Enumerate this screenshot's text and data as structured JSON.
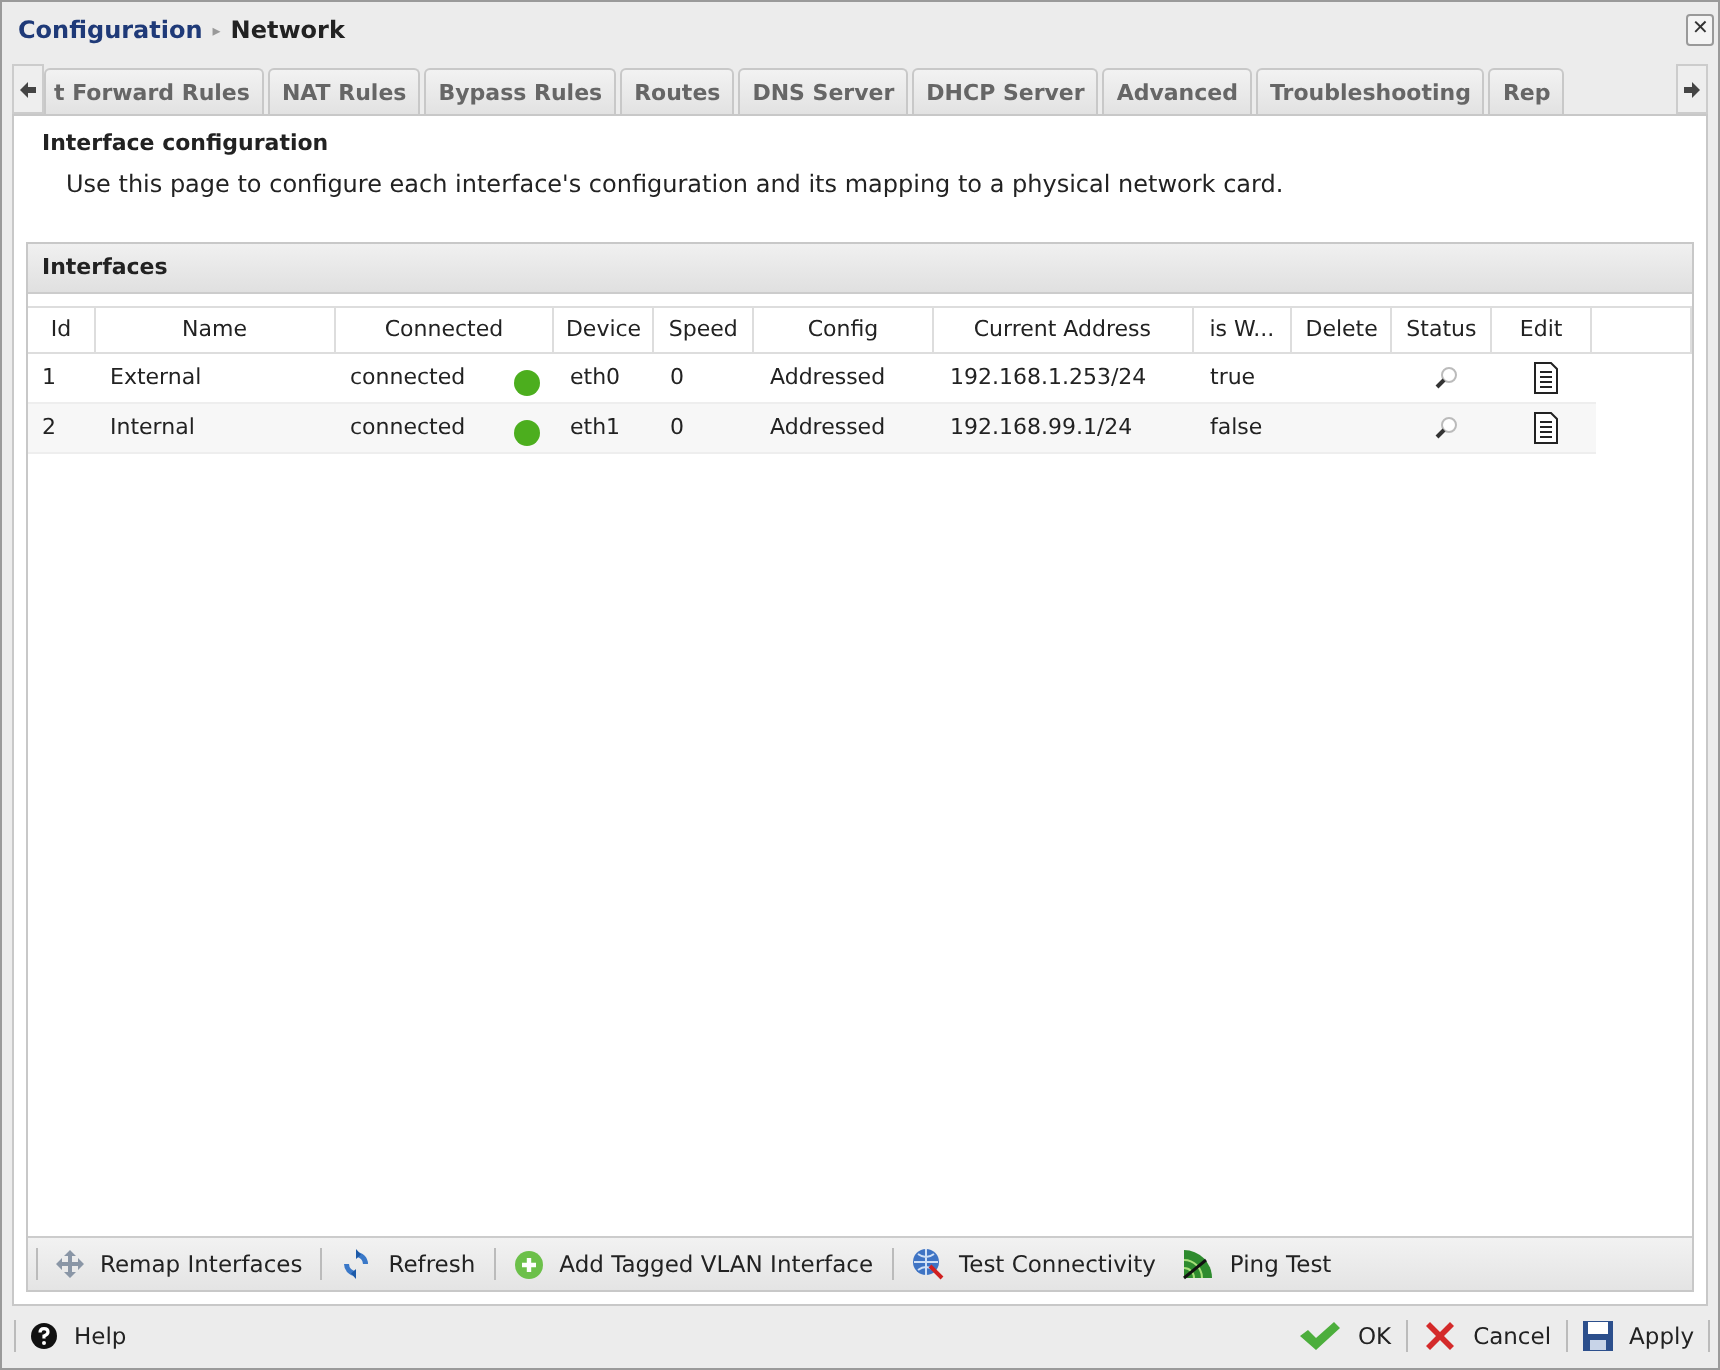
{
  "breadcrumb": {
    "parent": "Configuration",
    "separator": "▸",
    "current": "Network"
  },
  "close": "✕",
  "tabs": [
    {
      "label": "t Forward Rules",
      "selected": false
    },
    {
      "label": "NAT Rules",
      "selected": false
    },
    {
      "label": "Bypass Rules",
      "selected": false
    },
    {
      "label": "Routes",
      "selected": false
    },
    {
      "label": "DNS Server",
      "selected": false
    },
    {
      "label": "DHCP Server",
      "selected": false
    },
    {
      "label": "Advanced",
      "selected": false
    },
    {
      "label": "Troubleshooting",
      "selected": false
    },
    {
      "label": "Rep",
      "selected": false
    }
  ],
  "heading": "Interface configuration",
  "description": "Use this page to configure each interface's configuration and its mapping to a physical network card.",
  "panel": {
    "title": "Interfaces",
    "columns": [
      "Id",
      "Name",
      "Connected",
      "Device",
      "Speed",
      "Config",
      "Current Address",
      "is W...",
      "Delete",
      "Status",
      "Edit"
    ],
    "rows": [
      {
        "id": "1",
        "name": "External",
        "connected": "connected",
        "connected_ok": true,
        "device": "eth0",
        "speed": "0",
        "config": "Addressed",
        "address": "192.168.1.253/24",
        "is_wan": "true"
      },
      {
        "id": "2",
        "name": "Internal",
        "connected": "connected",
        "connected_ok": true,
        "device": "eth1",
        "speed": "0",
        "config": "Addressed",
        "address": "192.168.99.1/24",
        "is_wan": "false"
      }
    ],
    "toolbar": [
      {
        "kind": "move",
        "label": "Remap Interfaces"
      },
      {
        "kind": "refresh",
        "label": "Refresh"
      },
      {
        "kind": "add",
        "label": "Add Tagged VLAN Interface"
      },
      {
        "kind": "globe",
        "label": "Test Connectivity"
      },
      {
        "kind": "radar",
        "label": "Ping Test"
      }
    ]
  },
  "footer": {
    "help": "Help",
    "buttons": [
      {
        "kind": "ok",
        "label": "OK"
      },
      {
        "kind": "cancel",
        "label": "Cancel"
      },
      {
        "kind": "apply",
        "label": "Apply"
      }
    ]
  }
}
